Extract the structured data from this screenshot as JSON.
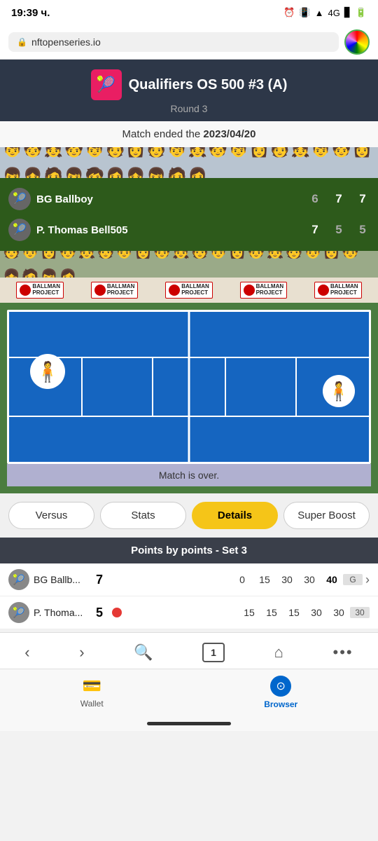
{
  "statusBar": {
    "time": "19:39 ч.",
    "icons": [
      "alarm",
      "vibrate",
      "wifi",
      "4G",
      "battery"
    ]
  },
  "browser": {
    "url": "nftopenseries.io",
    "avatarAlt": "profile-avatar"
  },
  "tournament": {
    "title": "Qualifiers OS 500 #3 (A)",
    "round": "Round 3",
    "matchEndedText": "Match ended the ",
    "matchEndedDate": "2023/04/20"
  },
  "players": [
    {
      "name": "BG Ballboy",
      "shortName": "BG Ballb...",
      "avatar": "🎾",
      "scores": [
        "6",
        "7",
        "7"
      ],
      "isWinner": true,
      "pointsSetScore": "7"
    },
    {
      "name": "P. Thomas Bell505",
      "shortName": "P. Thoma...",
      "avatar": "🎾",
      "scores": [
        "7",
        "5",
        "5"
      ],
      "isWinner": false,
      "pointsSetScore": "5",
      "hasServeIndicator": true
    }
  ],
  "courtStatus": "Match is over.",
  "tabs": [
    {
      "label": "Versus",
      "active": false
    },
    {
      "label": "Stats",
      "active": false
    },
    {
      "label": "Details",
      "active": true
    },
    {
      "label": "Super Boost",
      "active": false
    }
  ],
  "pointsSection": {
    "header": "Points by points - Set 3",
    "rows": [
      {
        "playerShort": "BG Ballb...",
        "setScore": "7",
        "cells": [
          "0",
          "15",
          "30",
          "30",
          "40"
        ],
        "overflowCell": "G",
        "hasServe": false
      },
      {
        "playerShort": "P. Thoma...",
        "setScore": "5",
        "cells": [
          "15",
          "15",
          "15",
          "30",
          "30"
        ],
        "overflowCell": "30",
        "hasServe": true
      }
    ]
  },
  "bottomNav": {
    "buttons": [
      {
        "icon": "‹",
        "name": "back"
      },
      {
        "icon": "›",
        "name": "forward"
      },
      {
        "icon": "🔍",
        "name": "search"
      },
      {
        "pageNum": "1",
        "name": "tabs"
      },
      {
        "icon": "⌂",
        "name": "home"
      },
      {
        "icon": "•••",
        "name": "more"
      }
    ]
  },
  "walletBar": {
    "wallet": {
      "label": "Wallet",
      "active": false
    },
    "browser": {
      "label": "Browser",
      "active": true
    }
  }
}
